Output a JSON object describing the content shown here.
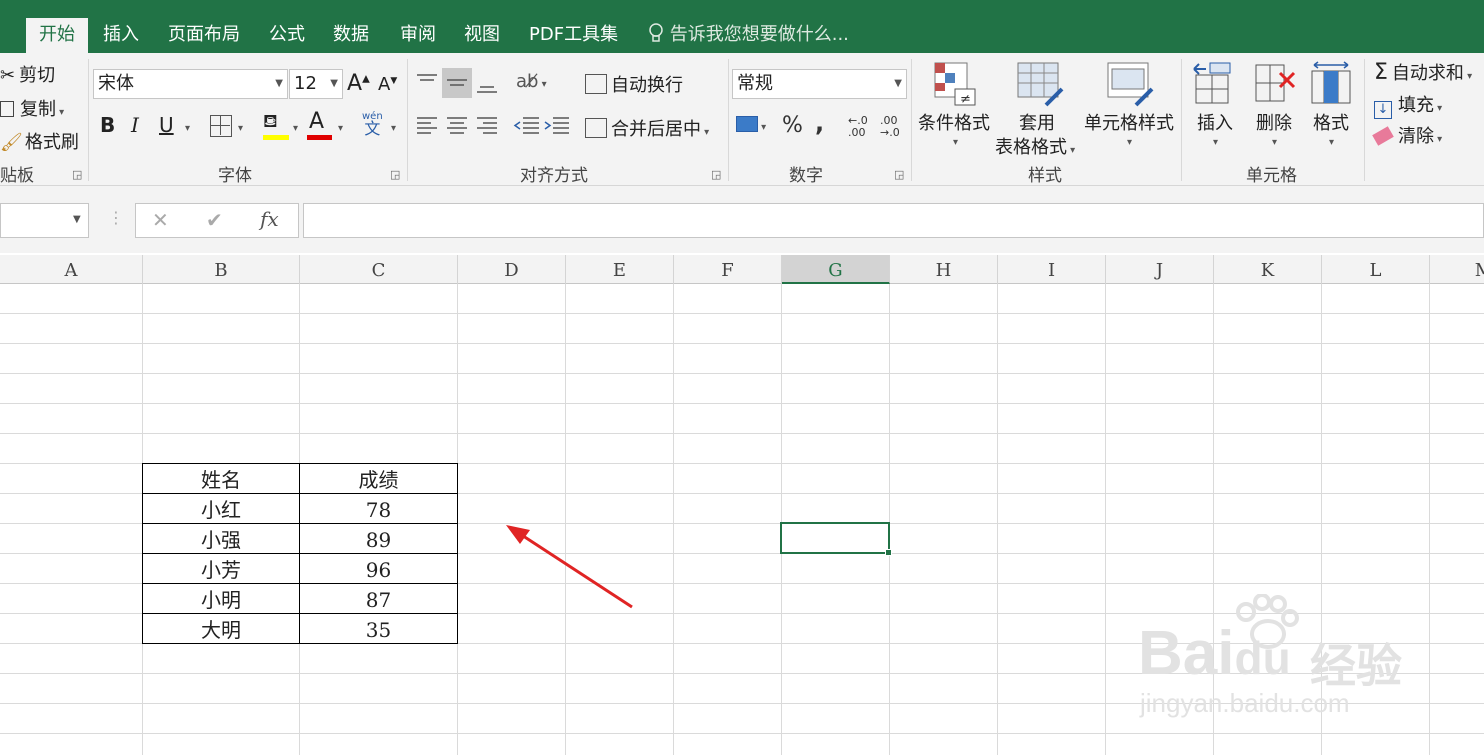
{
  "tabs": [
    "开始",
    "插入",
    "页面布局",
    "公式",
    "数据",
    "审阅",
    "视图",
    "PDF工具集"
  ],
  "tell_me": "告诉我您想要做什么...",
  "clipboard": {
    "cut": "剪切",
    "copy": "复制",
    "painter": "格式刷",
    "group": "贴板"
  },
  "font": {
    "name": "宋体",
    "size": "12",
    "group": "字体",
    "bold": "B",
    "italic": "I",
    "underline": "U",
    "font_color_glyph": "A",
    "phonetic_top": "wén",
    "phonetic_bottom": "文"
  },
  "alignment": {
    "wrap": "自动换行",
    "merge": "合并后居中",
    "group": "对齐方式"
  },
  "number": {
    "format": "常规",
    "percent": "%",
    "comma": ",",
    "inc_dec": "←.0 .00",
    "dec_dec": ".00 →.0",
    "group": "数字"
  },
  "styles": {
    "conditional": "条件格式",
    "table_line1": "套用",
    "table_line2": "表格格式",
    "cell_styles": "单元格样式",
    "group": "样式"
  },
  "cells": {
    "insert": "插入",
    "delete": "删除",
    "format": "格式",
    "group": "单元格"
  },
  "editing": {
    "autosum": "自动求和",
    "fill": "填充",
    "clear": "清除"
  },
  "formula_bar": {
    "cancel": "✕",
    "enter": "✔",
    "fx": "fx",
    "value": ""
  },
  "columns": [
    "A",
    "B",
    "C",
    "D",
    "E",
    "F",
    "G",
    "H",
    "I",
    "J",
    "K",
    "L",
    "M"
  ],
  "selected_column": "G",
  "table": {
    "headers": [
      "姓名",
      "成绩"
    ],
    "rows": [
      [
        "小红",
        "78"
      ],
      [
        "小强",
        "89"
      ],
      [
        "小芳",
        "96"
      ],
      [
        "小明",
        "87"
      ],
      [
        "大明",
        "35"
      ]
    ]
  },
  "annotation_color": "#e02424",
  "accent": "#217346",
  "watermark": {
    "brand": "Bai",
    "brand2": "du",
    "cn": "经验",
    "url": "jingyan.baidu.com"
  }
}
